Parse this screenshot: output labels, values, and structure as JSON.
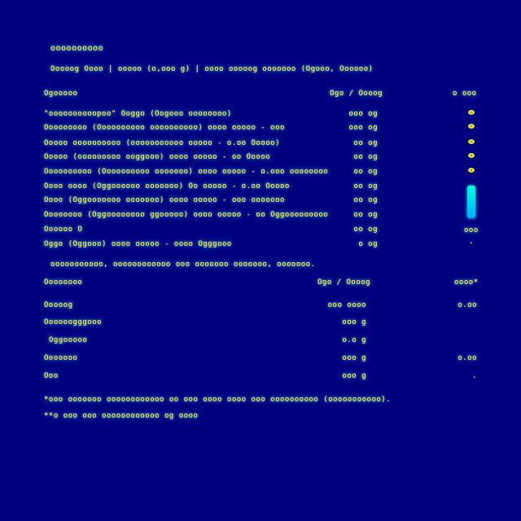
{
  "doc": {
    "title": "oooooooooo",
    "subtitle": "Ooooog Oooo | ooooo (o,ooo g) | oooo ooooog ooooooo (Ogooo, Oooooo)"
  },
  "section1": {
    "headers": [
      "Ogooooo",
      "Ogo / Oooog",
      "o ooo"
    ],
    "rows": [
      [
        "\"oooooooooopoo\" Ooggo (Oogooo oooooooo)",
        "ooo og"
      ],
      [
        "Ooooooooo (Oooooooooo oooooooooo) oooo ooooo - ooo",
        "ooo og"
      ],
      [
        "Ooooo oooooooooo (ooooooooooo ooooo - o.oo Ooooo)",
        "oo og"
      ],
      [
        "Ooooo (ooooooooo ooggooo) oooo ooooo - oo Ooooo",
        "oo og"
      ],
      [
        "Oooooooooo (Oooooooooo ooooooo) oooo ooooo - o.ooo oooooooo",
        "oo og"
      ],
      [
        "Oooo oooo (Oggoooooo ooooooo) Oo ooooo - o.oo Ooooo",
        "oo og"
      ],
      [
        "Oooo (Oggooooooo ooooooo) oooo ooooo - ooo ooooooo",
        "oo og"
      ],
      [
        "Oooooooo (Oggoooooooo ggooooo) oooo ooooo - oo Oggooooooooo",
        "oo og"
      ],
      [
        "Oooooo O",
        "oo og"
      ],
      [
        "Oggo (Oggooo) oooo ooooo - oooo Ogggooo",
        "o og"
      ]
    ],
    "dv_values": [
      "ooo",
      "."
    ],
    "note": "ooooooooooo, oooooooooooo ooo ooooooo ooooooo, ooooooo."
  },
  "section2": {
    "headers": [
      "Oooooooo",
      "Ogo / Oooog",
      "oooo*"
    ],
    "rows": [
      [
        "Ooooog",
        "ooo oooo",
        "o.oo"
      ],
      [
        "Oooooogggooo",
        "ooo g",
        ""
      ],
      [
        "Oggooooo",
        "o.o g",
        ""
      ],
      [
        "Ooooooo",
        "ooo g",
        "o.oo"
      ],
      [
        "Ooo",
        "ooo g",
        "."
      ]
    ]
  },
  "footnotes": [
    "*ooo ooooooo oooooooooooo oo ooo oooo oooo ooo oooooooooo (ooooooooooo).",
    "**o ooo ooo oooooooooooo og oooo"
  ],
  "colors": {
    "background": "#00007f",
    "text": "#ffff66",
    "glow": "#00ffcc"
  }
}
